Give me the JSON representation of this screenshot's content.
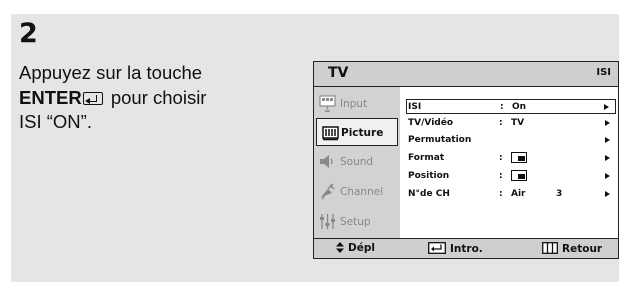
{
  "step": {
    "number": "2",
    "line1": "Appuyez sur la touche",
    "enter_word": "ENTER",
    "enter_icon": "enter-icon",
    "line2_rest": " pour choisir",
    "line3": "ISI “ON”."
  },
  "osd": {
    "title": "TV",
    "subtitle": "ISI",
    "sidebar": [
      {
        "label": "Input",
        "icon": "input-icon",
        "active": false
      },
      {
        "label": "Picture",
        "icon": "picture-icon",
        "active": true
      },
      {
        "label": "Sound",
        "icon": "sound-icon",
        "active": false
      },
      {
        "label": "Channel",
        "icon": "channel-icon",
        "active": false
      },
      {
        "label": "Setup",
        "icon": "setup-icon",
        "active": false
      }
    ],
    "rows": [
      {
        "name": "ISI",
        "colon": ":",
        "value": "On",
        "number": "",
        "selected": true
      },
      {
        "name": "TV/Vidéo",
        "colon": ":",
        "value": "TV",
        "number": "",
        "selected": false
      },
      {
        "name": "Permutation",
        "colon": "",
        "value": "",
        "number": "",
        "selected": false
      },
      {
        "name": "Format",
        "colon": ":",
        "value": "",
        "icon": "pip-size-icon",
        "number": "",
        "selected": false
      },
      {
        "name": "Position",
        "colon": ":",
        "value": "",
        "icon": "pip-position-icon",
        "number": "",
        "selected": false
      },
      {
        "name": "N°de CH",
        "colon": ":",
        "value": "Air",
        "number": "3",
        "selected": false
      }
    ],
    "footer": {
      "move": "Dépl",
      "enter": "Intro.",
      "back": "Retour"
    }
  }
}
